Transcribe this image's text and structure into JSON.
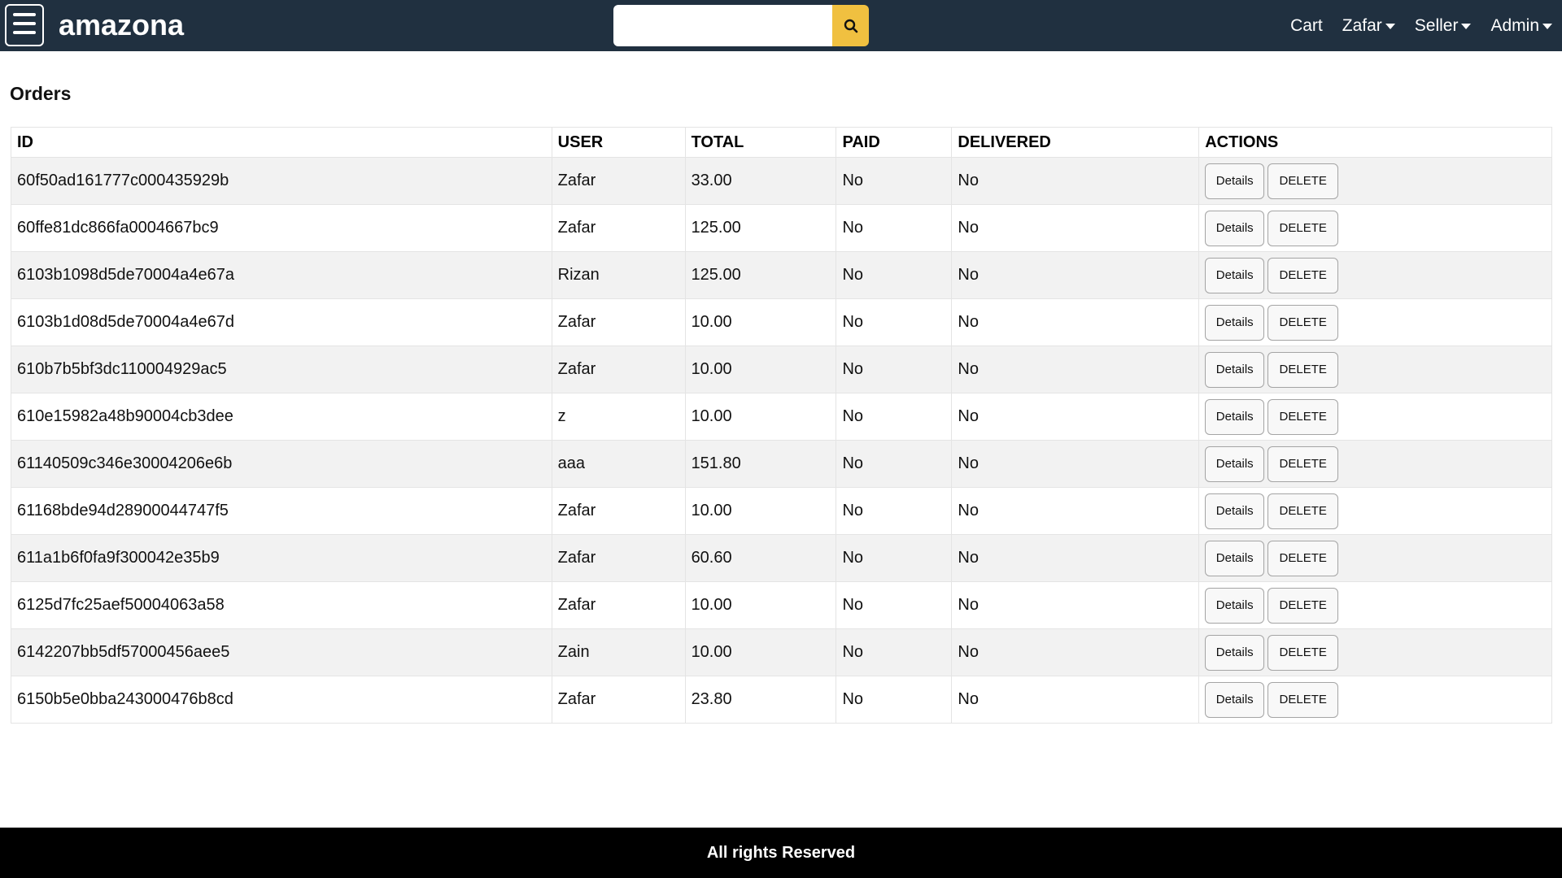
{
  "header": {
    "brand": "amazona",
    "search": {
      "value": "",
      "placeholder": ""
    },
    "nav": {
      "cart": "Cart",
      "user": "Zafar",
      "seller": "Seller",
      "admin": "Admin"
    }
  },
  "colors": {
    "header_bg": "#203040",
    "search_button": "#f0c040",
    "footer_bg": "#000000"
  },
  "icons": {
    "menu": "hamburger-icon",
    "search": "search-icon",
    "dropdown": "caret-down-icon"
  },
  "main": {
    "title": "Orders",
    "table": {
      "headers": [
        "ID",
        "USER",
        "TOTAL",
        "PAID",
        "DELIVERED",
        "ACTIONS"
      ],
      "details_label": "Details",
      "delete_label": "DELETE",
      "rows": [
        {
          "id": "60f50ad161777c000435929b",
          "user": "Zafar",
          "total": "33.00",
          "paid": "No",
          "delivered": "No"
        },
        {
          "id": "60ffe81dc866fa0004667bc9",
          "user": "Zafar",
          "total": "125.00",
          "paid": "No",
          "delivered": "No"
        },
        {
          "id": "6103b1098d5de70004a4e67a",
          "user": "Rizan",
          "total": "125.00",
          "paid": "No",
          "delivered": "No"
        },
        {
          "id": "6103b1d08d5de70004a4e67d",
          "user": "Zafar",
          "total": "10.00",
          "paid": "No",
          "delivered": "No"
        },
        {
          "id": "610b7b5bf3dc110004929ac5",
          "user": "Zafar",
          "total": "10.00",
          "paid": "No",
          "delivered": "No"
        },
        {
          "id": "610e15982a48b90004cb3dee",
          "user": "z",
          "total": "10.00",
          "paid": "No",
          "delivered": "No"
        },
        {
          "id": "61140509c346e30004206e6b",
          "user": "aaa",
          "total": "151.80",
          "paid": "No",
          "delivered": "No"
        },
        {
          "id": "61168bde94d28900044747f5",
          "user": "Zafar",
          "total": "10.00",
          "paid": "No",
          "delivered": "No"
        },
        {
          "id": "611a1b6f0fa9f300042e35b9",
          "user": "Zafar",
          "total": "60.60",
          "paid": "No",
          "delivered": "No"
        },
        {
          "id": "6125d7fc25aef50004063a58",
          "user": "Zafar",
          "total": "10.00",
          "paid": "No",
          "delivered": "No"
        },
        {
          "id": "6142207bb5df57000456aee5",
          "user": "Zain",
          "total": "10.00",
          "paid": "No",
          "delivered": "No"
        },
        {
          "id": "6150b5e0bba243000476b8cd",
          "user": "Zafar",
          "total": "23.80",
          "paid": "No",
          "delivered": "No"
        }
      ]
    }
  },
  "footer": {
    "text": "All rights Reserved"
  }
}
